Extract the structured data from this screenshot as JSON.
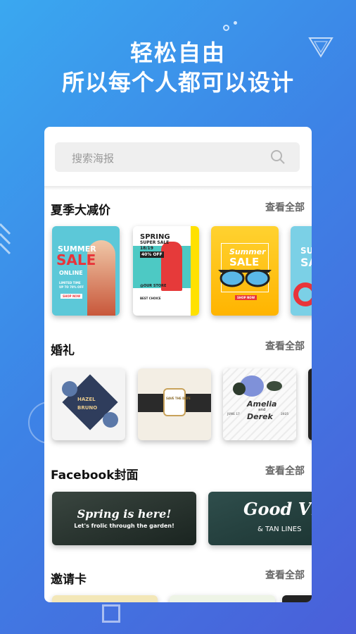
{
  "hero": {
    "line1": "轻松自由",
    "line2": "所以每个人都可以设计"
  },
  "search": {
    "placeholder": "搜索海报"
  },
  "sections": [
    {
      "title": "夏季大减价",
      "more": "查看全部"
    },
    {
      "title": "婚礼",
      "more": "查看全部"
    },
    {
      "title": "Facebook封面",
      "more": "查看全部"
    },
    {
      "title": "邀请卡",
      "more": "查看全部"
    }
  ],
  "summer": {
    "card1": {
      "line1": "SUMMER",
      "line2": "SALE",
      "line3": "ONLINE",
      "line4": "LIMITED TIME",
      "line5": "UP TO 70% OFF",
      "button": "SHOP NOW"
    },
    "card2": {
      "line1": "SPRING",
      "line2": "SUPER SALE",
      "line3": "18/19",
      "line4": "40% OFF",
      "line5": "@OUR STORE",
      "line6": "BEST CHOICE"
    },
    "card3": {
      "line1": "Summer",
      "line2": "SALE",
      "button": "SHOP NOW"
    },
    "card4": {
      "line1": "SU",
      "line2": "SA"
    }
  },
  "wedding": {
    "card1": {
      "line1": "HAZEL",
      "line2": "BRUNO"
    },
    "card2": {
      "line1": "SAVE THE DATE"
    },
    "card3": {
      "line1": "Amelia",
      "line2": "and",
      "line3": "Derek",
      "line4": "JUNE 17",
      "line5": "2025"
    }
  },
  "facebook": {
    "card1": {
      "line1": "Spring is here!",
      "line2": "Let's frolic through the garden!"
    },
    "card2": {
      "line1": "Good Vibe",
      "line2": "& TAN LINES"
    }
  },
  "colors": {
    "bg_start": "#3aa8f0",
    "bg_end": "#4a5fd9",
    "summer_teal": "#5cc8d8",
    "summer_yellow": "#ffc21a",
    "sale_red": "#e8343a"
  }
}
